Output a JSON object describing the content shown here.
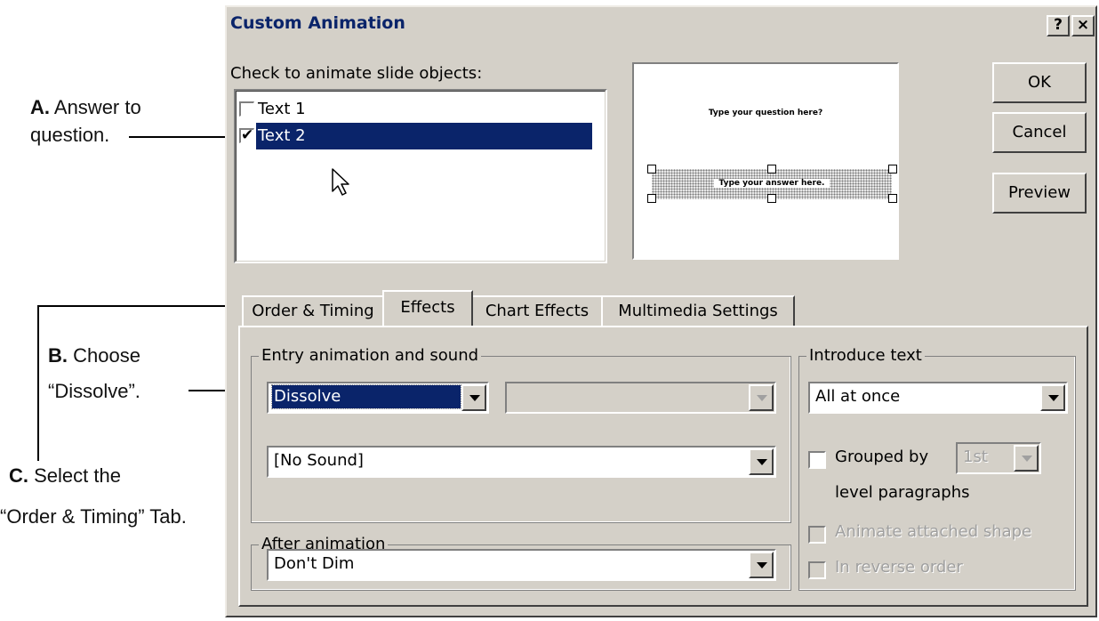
{
  "annotations": {
    "a_letter": "A.",
    "a_text_1": " Answer to",
    "a_text_2": "question.",
    "b_letter": "B.",
    "b_text_1": " Choose",
    "b_text_2": "“Dissolve”.",
    "c_letter": "C.",
    "c_text_1": " Select the",
    "c_text_2": "“Order & Timing” Tab."
  },
  "dialog": {
    "title": "Custom Animation",
    "help_button": "?",
    "close_button": "×",
    "objects_label": "Check to animate slide objects:",
    "objects": [
      {
        "label": "Text 1",
        "checked": false,
        "selected": false
      },
      {
        "label": "Text 2",
        "checked": true,
        "selected": true
      }
    ],
    "preview": {
      "question_text": "Type your question here?",
      "answer_text": "Type your answer here."
    },
    "buttons": {
      "ok": "OK",
      "cancel": "Cancel",
      "preview": "Preview"
    },
    "tabs": [
      "Order & Timing",
      "Effects",
      "Chart Effects",
      "Multimedia Settings"
    ],
    "active_tab": "Effects",
    "entry_group_label": "Entry animation and sound",
    "entry_effect": "Dissolve",
    "entry_sound": "[No Sound]",
    "after_group_label": "After animation",
    "after_value": "Don't Dim",
    "introduce_group_label": "Introduce text",
    "introduce_value": "All at once",
    "grouped_by_label": "Grouped by",
    "grouped_by_value": "1st",
    "level_paragraphs": "level paragraphs",
    "animate_attached": "Animate attached shape",
    "reverse_order": "In reverse order"
  },
  "colors": {
    "selection": "#0a246a",
    "face": "#d4d0c8",
    "title_text": "#0a246a"
  },
  "icons": {
    "check": "check-icon",
    "cursor": "mouse-pointer-icon",
    "dropdown": "chevron-down-icon"
  }
}
